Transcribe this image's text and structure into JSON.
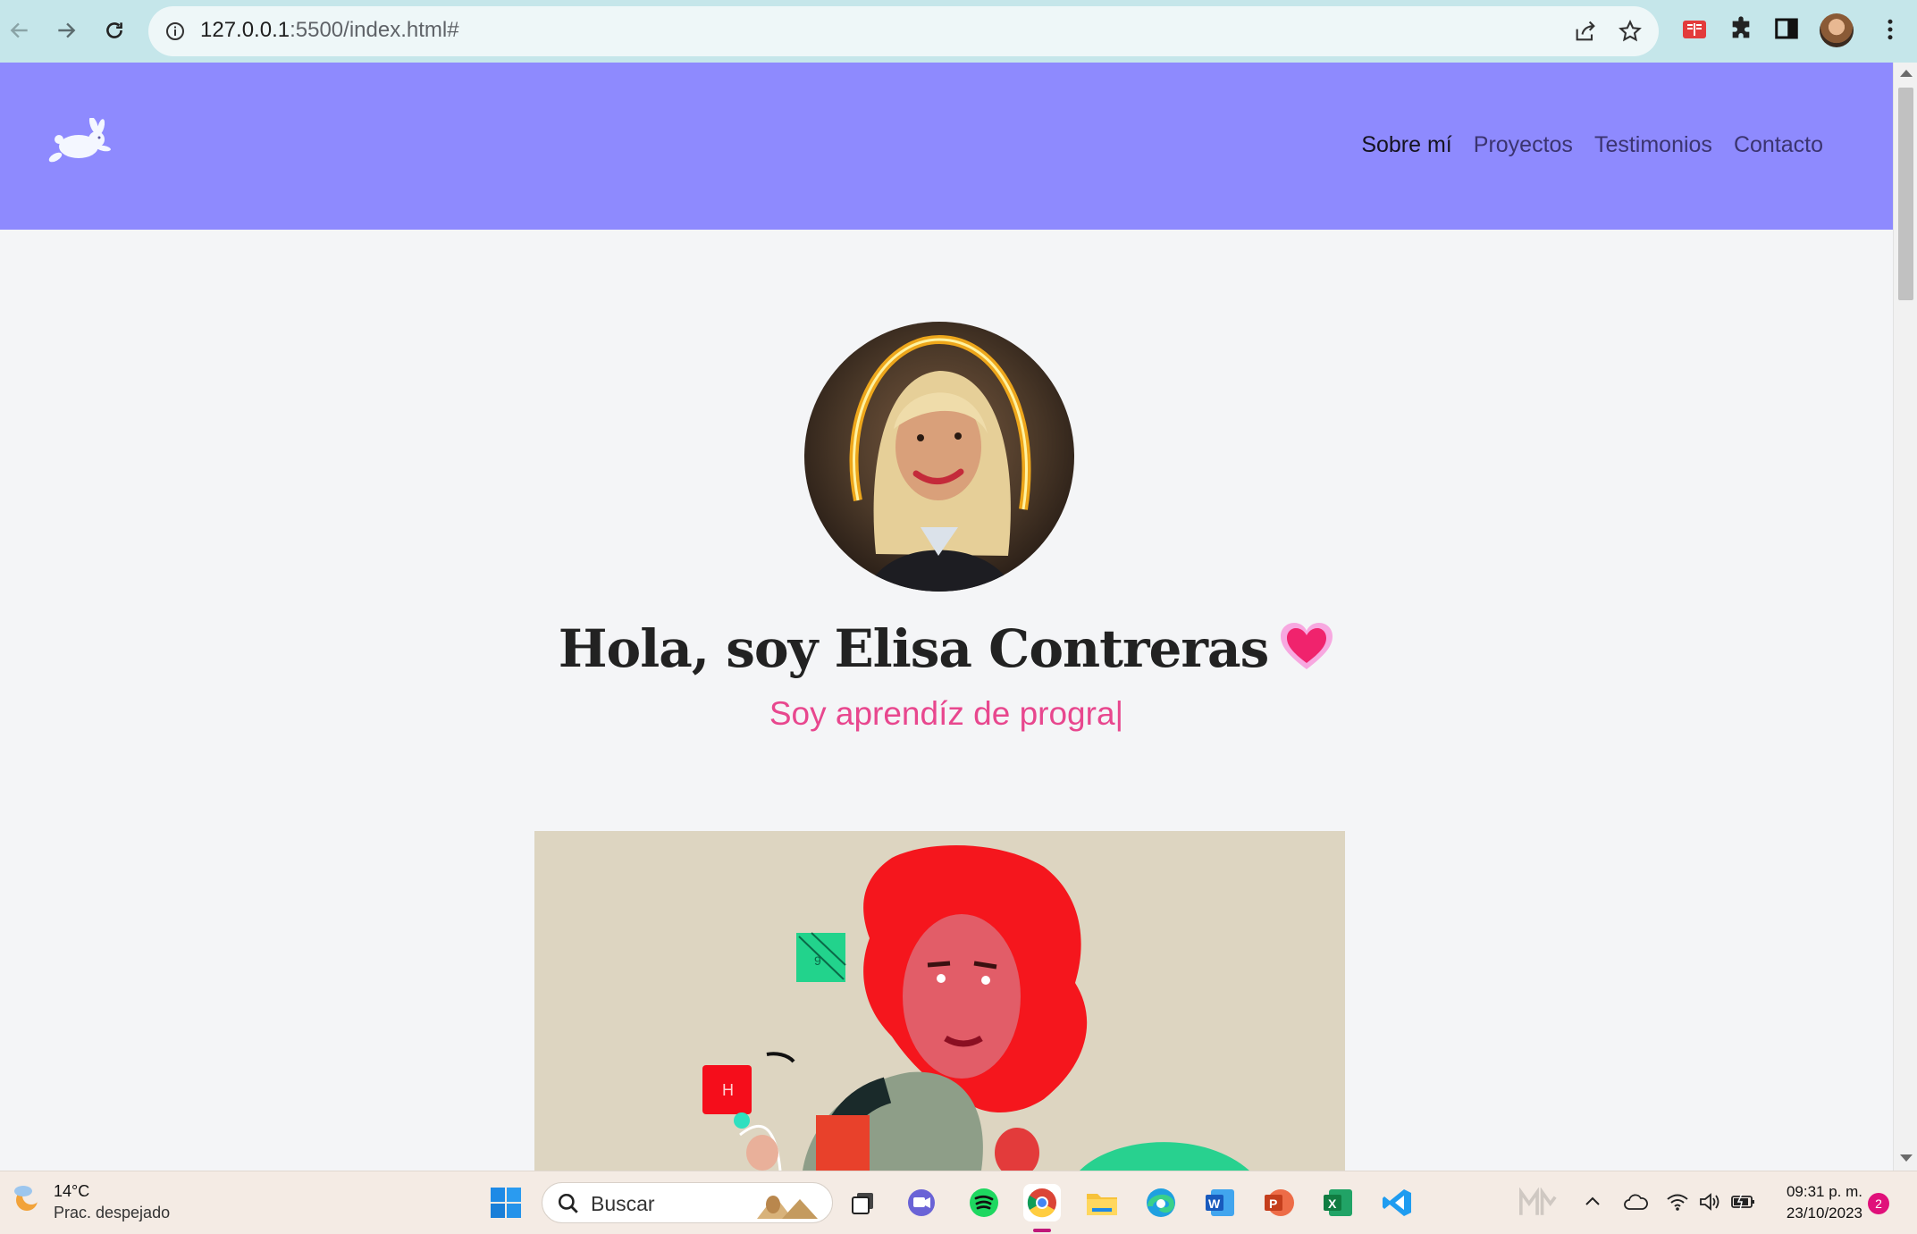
{
  "browser": {
    "url_host": "127.0.0.1",
    "url_rest": ":5500/index.html#"
  },
  "site": {
    "nav": [
      {
        "label": "Sobre mí",
        "active": true
      },
      {
        "label": "Proyectos",
        "active": false
      },
      {
        "label": "Testimonios",
        "active": false
      },
      {
        "label": "Contacto",
        "active": false
      }
    ],
    "hero_title": "Hola, soy Elisa Contreras",
    "hero_subtitle": "Soy aprendíz de progra",
    "cursor": "|"
  },
  "taskbar": {
    "weather_temp": "14°C",
    "weather_condition": "Prac. despejado",
    "search_placeholder": "Buscar",
    "time": "09:31 p. m.",
    "date": "23/10/2023",
    "notification_count": "2"
  },
  "colors": {
    "header_bg": "#8e8afe",
    "accent_pink": "#e8478e",
    "page_bg": "#f4f5f7"
  }
}
